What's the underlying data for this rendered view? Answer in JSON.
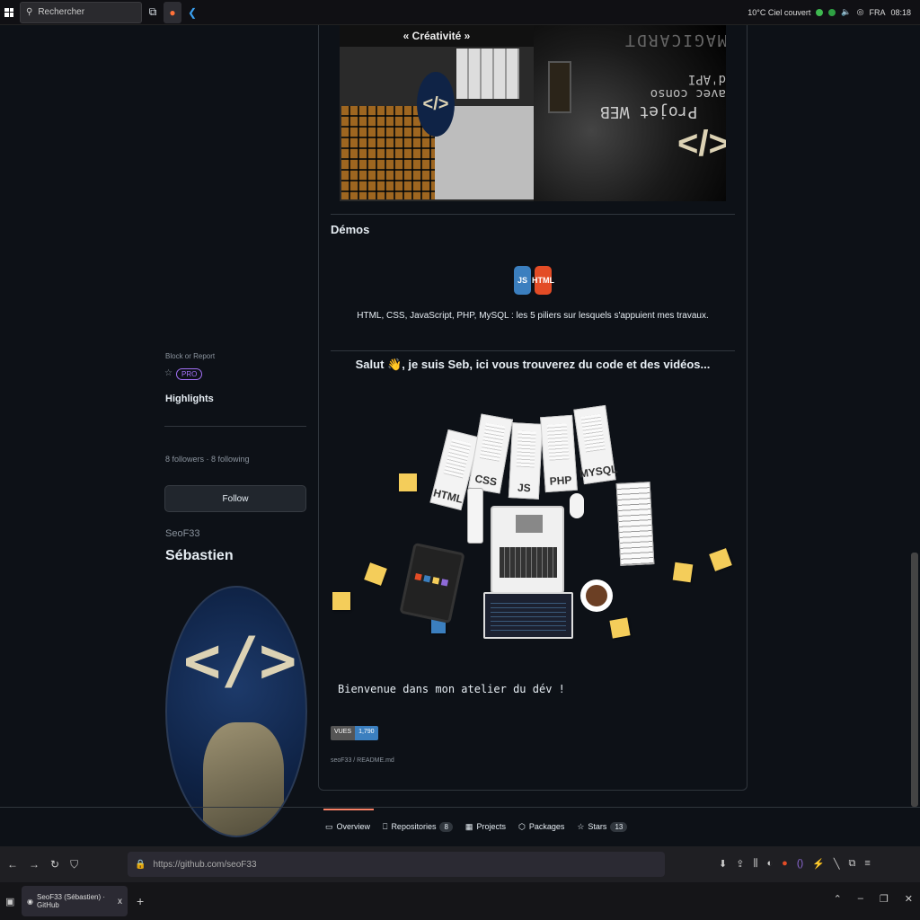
{
  "taskbar": {
    "search_placeholder": "Rechercher",
    "weather": "10°C Ciel couvert",
    "lang": "FRA",
    "time": "08:18"
  },
  "profile": {
    "name": "Sébastien",
    "login": "SeoF33",
    "follow_label": "Follow",
    "followers_text": "8 followers · 8 following",
    "highlights_title": "Highlights",
    "pro_label": "PRO",
    "block_report": "Block or Report"
  },
  "readme": {
    "path": "seoF33 / README.md",
    "views_key": "VUES",
    "views_value": "1,790",
    "welcome": "Bienvenue dans mon atelier du dév !",
    "intro": "Salut 👋, je suis Seb, ici vous trouverez du code et des vidéos...",
    "stack_text": "HTML, CSS, JavaScript, PHP, MySQL : les 5 piliers sur lesquels s'appuient mes travaux.",
    "demos_title": "Démos",
    "papers": [
      "HTML",
      "CSS",
      "JS",
      "PHP",
      "MYSQL"
    ],
    "creativity_label": "« Créativité »",
    "project_line1": "Projet WEB",
    "project_line2": "avec conso d'API",
    "project_line3": "MAGICARDT",
    "code_glyph": "</>",
    "stack_icons": [
      "HTML",
      "JS"
    ]
  },
  "tabs": [
    {
      "label": "Overview",
      "icon": "book-icon",
      "count": ""
    },
    {
      "label": "Repositories",
      "icon": "repo-icon",
      "count": "8"
    },
    {
      "label": "Projects",
      "icon": "table-icon",
      "count": ""
    },
    {
      "label": "Packages",
      "icon": "package-icon",
      "count": ""
    },
    {
      "label": "Stars",
      "icon": "star-icon",
      "count": "13"
    }
  ],
  "browser": {
    "url": "https://github.com/seoF33",
    "tab_title": "SeoF33 (Sébastien) · GitHub",
    "tab_close": "x",
    "new_tab": "+"
  },
  "colors": {
    "bg": "#0d1117",
    "accent": "#f78166",
    "pro": "#a371f7"
  }
}
